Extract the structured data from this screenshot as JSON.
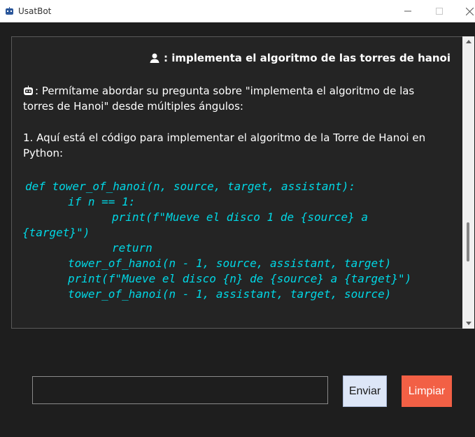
{
  "window": {
    "title": "UsatBot",
    "icon": "robot-icon"
  },
  "chat": {
    "user_message": ": implementa el algoritmo de las torres de hanoi",
    "bot_lines": [
      ": Permítame abordar su pregunta sobre \"implementa el algoritmo de las",
      "torres de Hanoi\" desde múltiples ángulos:",
      "1. Aquí está el código para implementar el algoritmo de la Torre de Hanoi en",
      "Python:"
    ],
    "code_lines": [
      "def tower_of_hanoi(n, source, target, assistant):",
      "if n == 1:",
      "print(f\"Mueve el disco 1 de {source} a",
      "{target}\")",
      "return",
      "tower_of_hanoi(n - 1, source, assistant, target)",
      "print(f\"Mueve el disco {n} de {source} a {target}\")",
      "tower_of_hanoi(n - 1, assistant, target, source)"
    ]
  },
  "input": {
    "value": "",
    "placeholder": ""
  },
  "buttons": {
    "send_label": "Enviar",
    "clear_label": "Limpiar"
  },
  "colors": {
    "background": "#1e1e1e",
    "chat_background": "#242424",
    "code": "#00d8e6",
    "send_button": "#dde6f7",
    "clear_button": "#f26045"
  }
}
